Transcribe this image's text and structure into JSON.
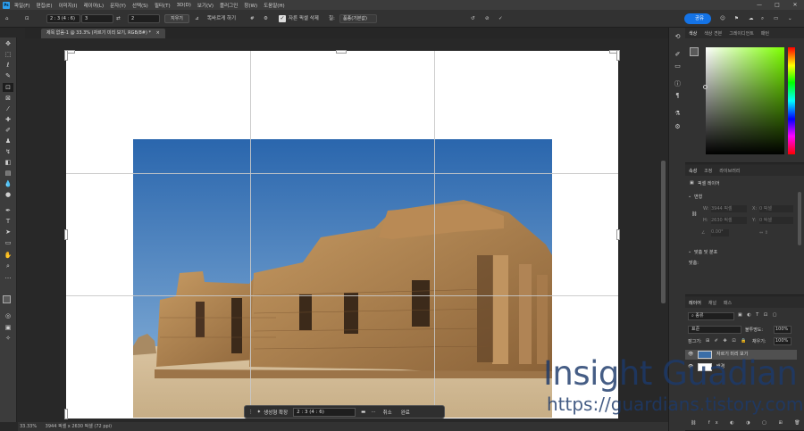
{
  "menubar": {
    "app_logo": "Ps",
    "items": [
      "파일(F)",
      "편집(E)",
      "이미지(I)",
      "레이어(L)",
      "문자(Y)",
      "선택(S)",
      "필터(T)",
      "3D(D)",
      "보기(V)",
      "플러그인",
      "창(W)",
      "도움말(H)"
    ],
    "window_controls": [
      "—",
      "□",
      "✕"
    ]
  },
  "options": {
    "ratio_select": "2 : 3 (4 : 6)",
    "width_value": "3",
    "height_value": "2",
    "clear_label": "지우기",
    "straighten_label": "똑바르게 하기",
    "delete_cropped_label": "자른 픽셀 삭제",
    "fill_label": "칠:",
    "fill_value": "품종(기본값)",
    "share_label": "공유"
  },
  "doc_tab": {
    "title": "제목 없음-1 @ 33.3% (자르기 미리 보기, RGB/8#) *",
    "close": "×"
  },
  "context_bar": {
    "generative_expand": "생성형 확장",
    "ratio": "2 : 3 (4 : 6)",
    "cancel": "취소",
    "done": "완료"
  },
  "status": {
    "zoom": "33.33%",
    "info": "3944 픽셀 x 2630 픽셀 (72 ppi)"
  },
  "color_panel": {
    "tabs": [
      "색상",
      "색상 견본",
      "그레이디언트",
      "패턴"
    ]
  },
  "properties_panel": {
    "tabs": [
      "속성",
      "조정",
      "라이브러리"
    ],
    "layer_type": "픽셀 레이어",
    "transform_section": "변형",
    "w_label": "W:",
    "w_value": "3944 픽셀",
    "h_label": "H:",
    "h_value": "2630 픽셀",
    "x_label": "X:",
    "x_value": "0 픽셀",
    "y_label": "Y:",
    "y_value": "0 픽셀",
    "angle_value": "0.00°",
    "align_section": "맞춤 및 분포",
    "align_label": "맞춤:"
  },
  "layers_panel": {
    "tabs": [
      "레이어",
      "채널",
      "패스"
    ],
    "search_placeholder": "종류",
    "blend_mode": "표준",
    "opacity_label": "불투명도:",
    "opacity_value": "100%",
    "lock_label": "잠그기:",
    "fill_label": "채우기:",
    "fill_value": "100%",
    "layers": [
      {
        "name": "자르기 미리 보기",
        "selected": true
      },
      {
        "name": "배경",
        "selected": false
      }
    ]
  },
  "watermark": {
    "title": "Insight Guadian",
    "url": "https://guardians.tistory.com"
  },
  "colors": {
    "foreground": "#5a5a5a",
    "background": "#ffffff",
    "accent": "#2da0f0",
    "share_button": "#1473e6"
  }
}
